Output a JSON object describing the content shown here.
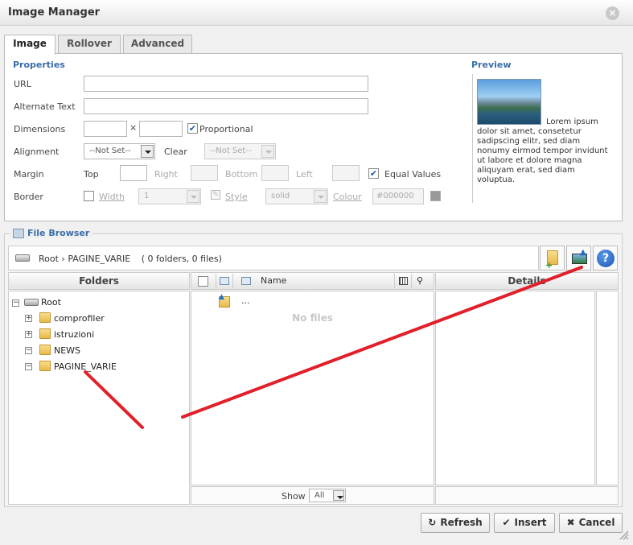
{
  "window": {
    "title": "Image Manager"
  },
  "tabs": [
    {
      "label": "Image"
    },
    {
      "label": "Rollover"
    },
    {
      "label": "Advanced"
    }
  ],
  "properties": {
    "title": "Properties",
    "url_label": "URL",
    "url_value": "",
    "alt_label": "Alternate Text",
    "alt_value": "",
    "dimensions_label": "Dimensions",
    "width_value": "",
    "times_sign": "×",
    "height_value": "",
    "proportional_label": "Proportional",
    "proportional_checked": true,
    "alignment_label": "Alignment",
    "alignment_value": "--Not Set--",
    "clear_label": "Clear",
    "clear_value": "--Not Set--",
    "margin_label": "Margin",
    "margin_top_label": "Top",
    "margin_right_label": "Right",
    "margin_bottom_label": "Bottom",
    "margin_left_label": "Left",
    "equal_values_label": "Equal Values",
    "equal_values_checked": true,
    "border_label": "Border",
    "border_width_label": "Width",
    "border_width_value": "1",
    "border_style_label": "Style",
    "border_style_value": "solid",
    "border_colour_label": "Colour",
    "border_colour_value": "#000000"
  },
  "preview": {
    "title": "Preview",
    "text": "Lorem ipsum dolor sit amet, consetetur sadipscing elitr, sed diam nonumy eirmod tempor invidunt ut labore et dolore magna aliquyam erat, sed diam voluptua."
  },
  "file_browser": {
    "title": "File Browser",
    "path_root": "Root",
    "path_sep": "›",
    "path_current": "PAGINE_VARIE",
    "path_counts": "( 0 folders, 0 files)",
    "folders_header": "Folders",
    "name_header": "Name",
    "details_header": "Details",
    "tree": {
      "root": "Root",
      "items": [
        {
          "label": "comprofiler",
          "expander": "+"
        },
        {
          "label": "istruzioni",
          "expander": "+"
        },
        {
          "label": "NEWS",
          "expander": "−"
        },
        {
          "label": "PAGINE_VARIE",
          "expander": "−"
        }
      ]
    },
    "up_label": "...",
    "empty_text": "No files",
    "show_label": "Show",
    "show_value": "All"
  },
  "buttons": {
    "refresh": "Refresh",
    "insert": "Insert",
    "cancel": "Cancel"
  },
  "colors": {
    "accent": "#3a6ea8",
    "annotation": "#e0202a"
  }
}
